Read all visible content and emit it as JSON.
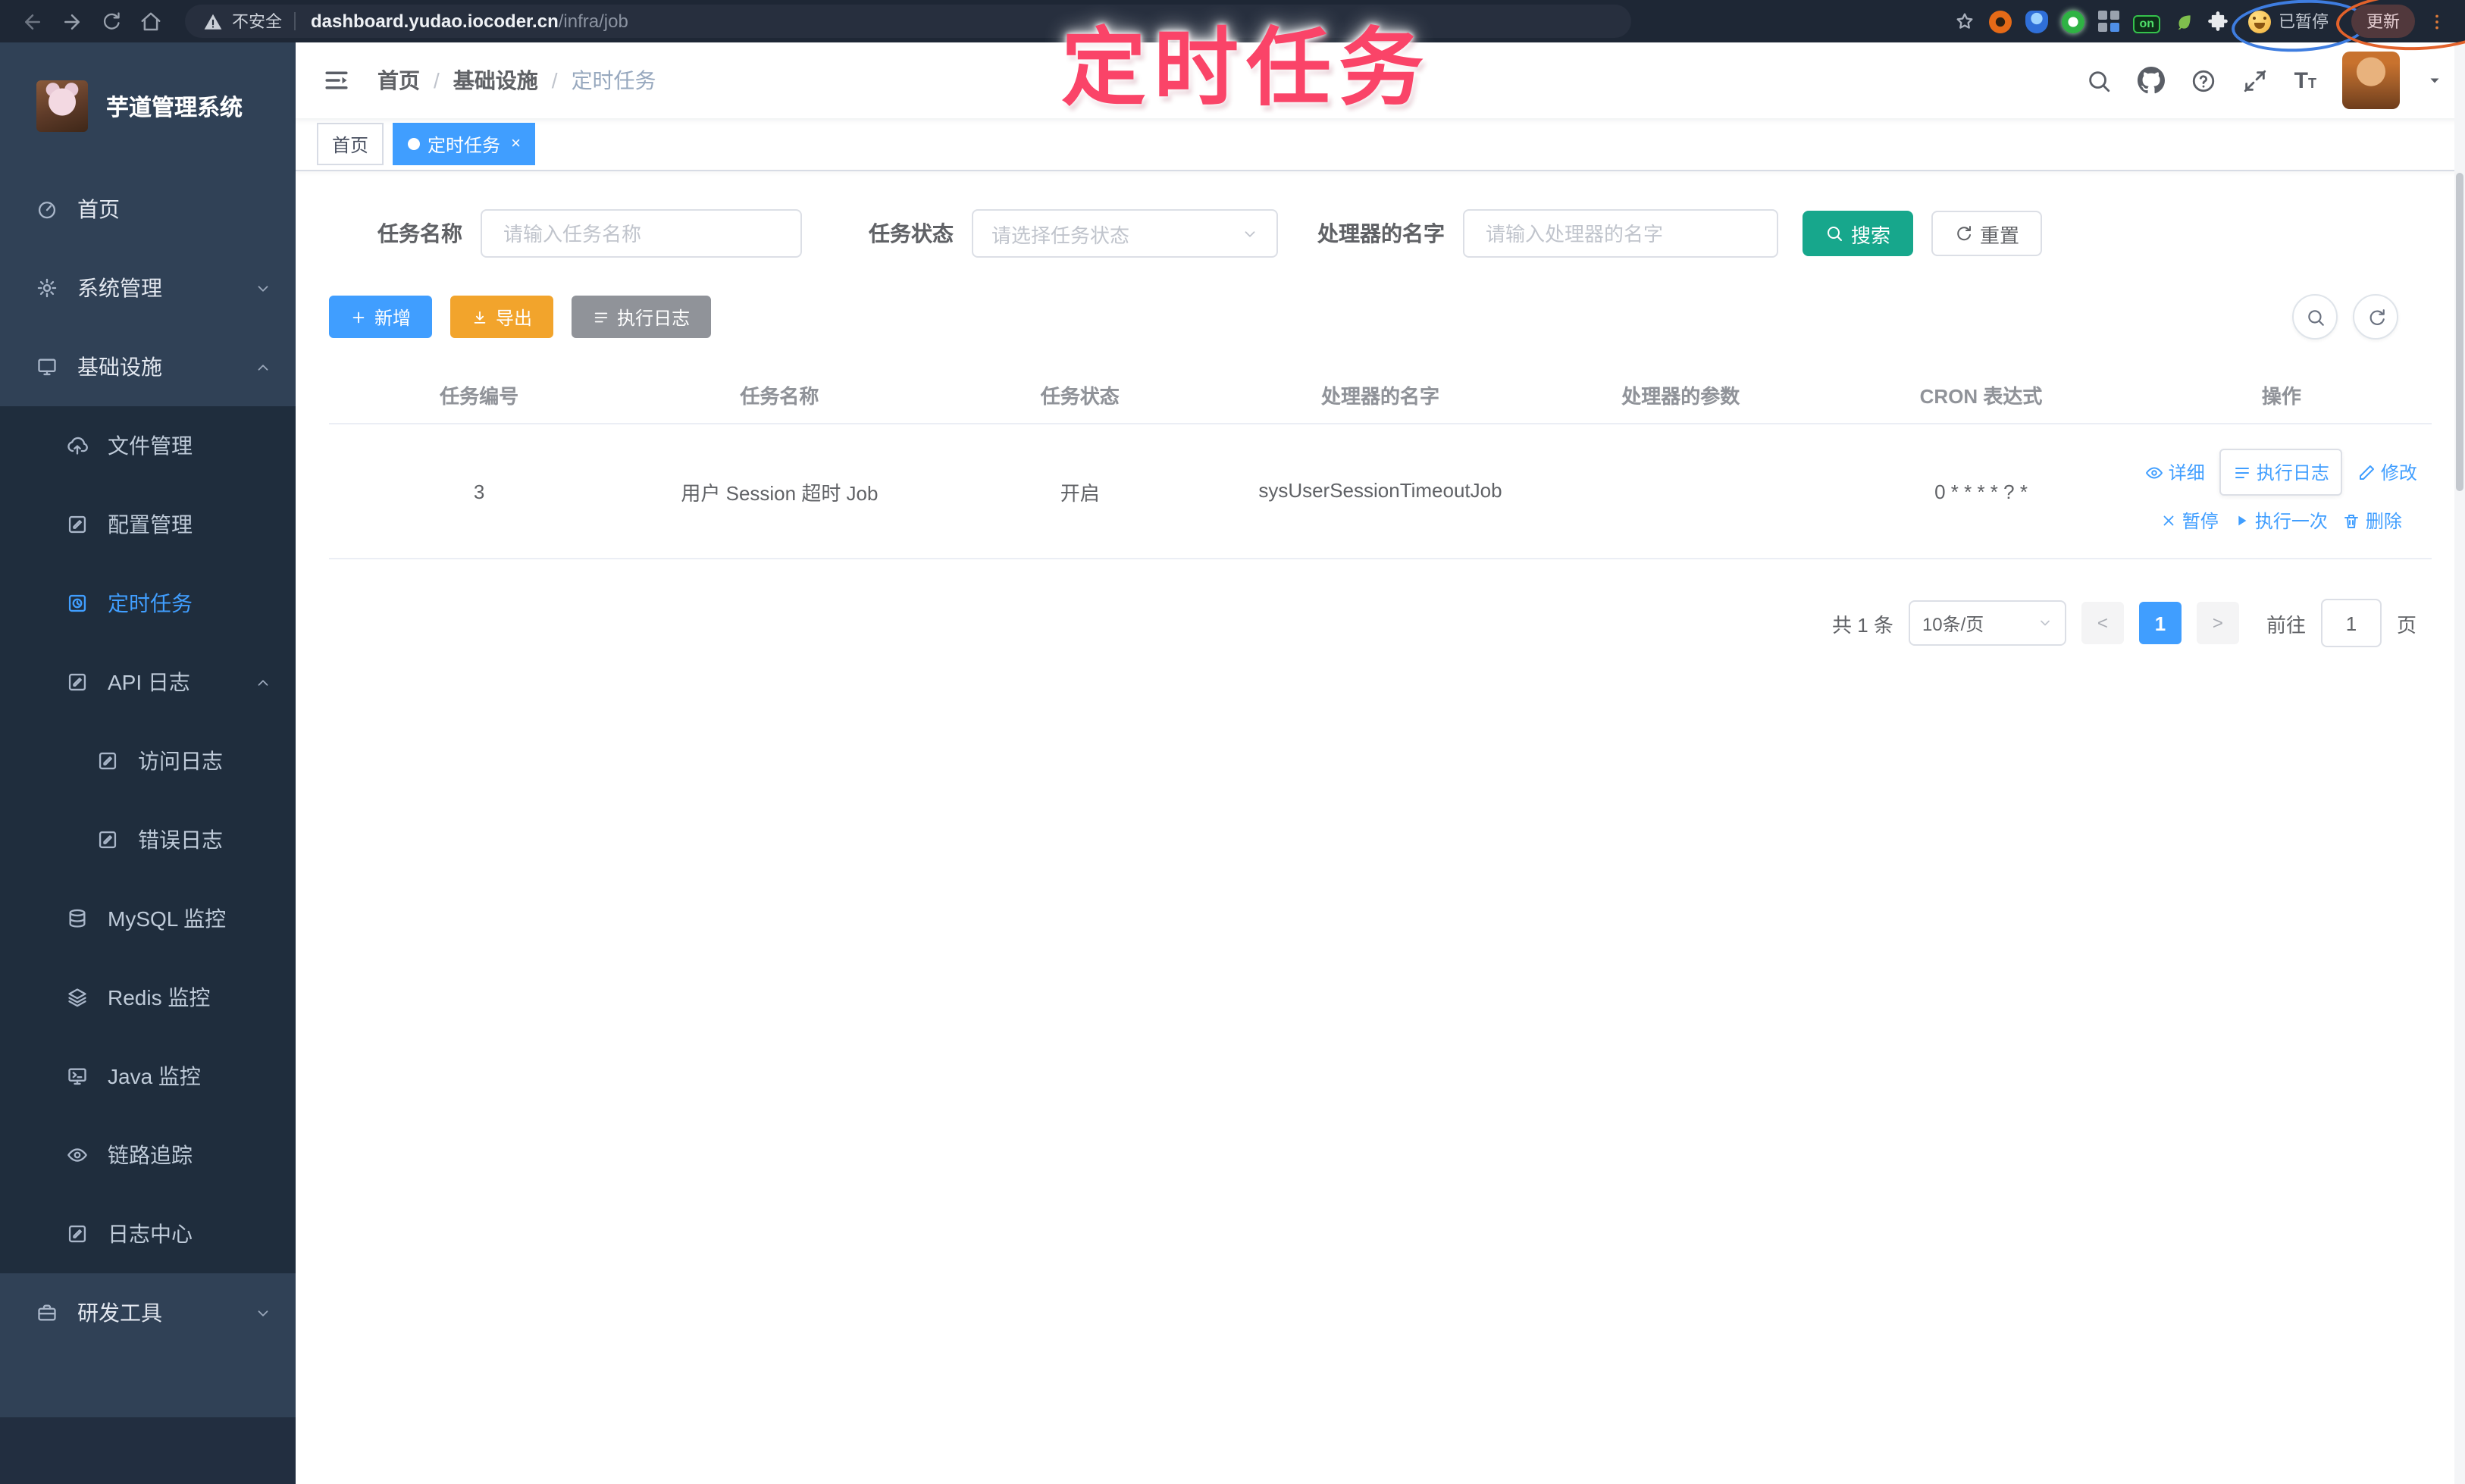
{
  "browser": {
    "security_label": "不安全",
    "url_domain": "dashboard.yudao.iocoder.cn",
    "url_path": "/infra/job",
    "extension_on_badge": "on",
    "paused_label": "已暂停",
    "update_label": "更新"
  },
  "annotation": {
    "title": "定时任务"
  },
  "sidebar": {
    "app_title": "芋道管理系统",
    "items": [
      {
        "label": "首页",
        "icon": "dashboard-icon",
        "level": 1
      },
      {
        "label": "系统管理",
        "icon": "gear-icon",
        "level": 1,
        "arrow": "down"
      },
      {
        "label": "基础设施",
        "icon": "monitor-icon",
        "level": 1,
        "arrow": "up"
      },
      {
        "label": "文件管理",
        "icon": "cloud-upload-icon",
        "level": 2
      },
      {
        "label": "配置管理",
        "icon": "edit-icon",
        "level": 2
      },
      {
        "label": "定时任务",
        "icon": "timer-icon",
        "level": 2,
        "active": true
      },
      {
        "label": "API 日志",
        "icon": "edit-icon",
        "level": 2,
        "arrow": "up"
      },
      {
        "label": "访问日志",
        "icon": "edit-icon",
        "level": 3
      },
      {
        "label": "错误日志",
        "icon": "edit-icon",
        "level": 3
      },
      {
        "label": "MySQL 监控",
        "icon": "database-icon",
        "level": 2
      },
      {
        "label": "Redis 监控",
        "icon": "layers-icon",
        "level": 2
      },
      {
        "label": "Java 监控",
        "icon": "terminal-icon",
        "level": 2
      },
      {
        "label": "链路追踪",
        "icon": "eye-icon",
        "level": 2
      },
      {
        "label": "日志中心",
        "icon": "edit-icon",
        "level": 2
      },
      {
        "label": "研发工具",
        "icon": "toolbox-icon",
        "level": 1,
        "arrow": "down"
      }
    ]
  },
  "header": {
    "breadcrumb": [
      "首页",
      "基础设施",
      "定时任务"
    ],
    "separator": "/",
    "icons": [
      "search-icon",
      "github-icon",
      "help-icon",
      "fullscreen-icon",
      "font-size-icon",
      "avatar",
      "caret-down-icon"
    ],
    "tabs": [
      {
        "label": "首页",
        "active": false
      },
      {
        "label": "定时任务",
        "active": true,
        "close": "×"
      }
    ]
  },
  "filters": {
    "name_label": "任务名称",
    "name_placeholder": "请输入任务名称",
    "status_label": "任务状态",
    "status_placeholder": "请选择任务状态",
    "handler_label": "处理器的名字",
    "handler_placeholder": "请输入处理器的名字",
    "search_label": "搜索",
    "reset_label": "重置"
  },
  "toolbar": {
    "add_label": "新增",
    "export_label": "导出",
    "exec_log_label": "执行日志"
  },
  "table": {
    "headers": [
      "任务编号",
      "任务名称",
      "任务状态",
      "处理器的名字",
      "处理器的参数",
      "CRON 表达式",
      "操作"
    ],
    "rows": [
      {
        "id": "3",
        "name": "用户 Session 超时 Job",
        "status": "开启",
        "handler": "sysUserSessionTimeoutJob",
        "param": "",
        "cron": "0 * * * * ? *"
      }
    ],
    "row_actions": [
      "详细",
      "执行日志",
      "修改",
      "暂停",
      "执行一次",
      "删除"
    ]
  },
  "pagination": {
    "total": "共 1 条",
    "page_size": "10条/页",
    "prev": "<",
    "current_page": "1",
    "next": ">",
    "goto_label": "前往",
    "goto_value": "1",
    "page_label": "页"
  }
}
